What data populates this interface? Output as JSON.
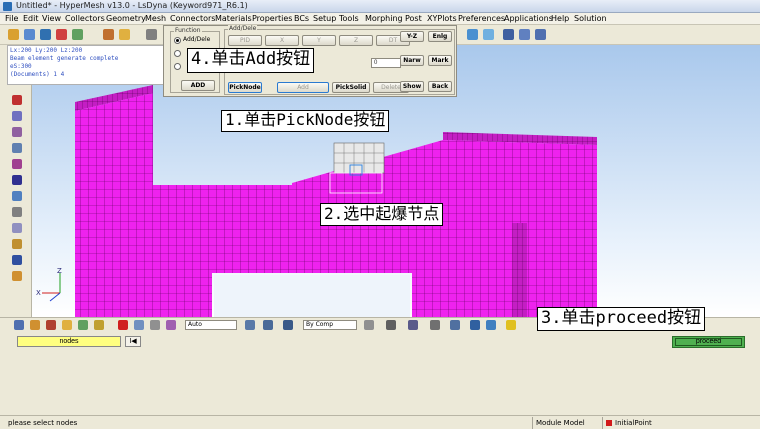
{
  "window": {
    "title": "Untitled* - HyperMesh v13.0 - LsDyna (Keyword971_R6.1)"
  },
  "menu": [
    "File",
    "Edit",
    "View",
    "Collectors",
    "Geometry",
    "Mesh",
    "Connectors",
    "Materials",
    "Properties",
    "BCs",
    "Setup",
    "Tools",
    "Morphing",
    "Post",
    "XYPlots",
    "Preferences",
    "Applications",
    "Help",
    "Solution"
  ],
  "command_log": [
    "Lx:200 Ly:200 Lz:200",
    "Beam element generate complete",
    "eS:300",
    "(Documents) 1 4"
  ],
  "function_panel": {
    "function_legend": "Function",
    "adddel_legend": "Add/Dele",
    "radio_adddele": "Add/Dele",
    "pid_label": "PID",
    "x_label": "X",
    "y_label": "Y",
    "z_label": "Z",
    "dt_label": "DT",
    "add_label": "ADD",
    "picknode_label": "PickNode",
    "add2_label": "Add",
    "picksolid_label": "PickSolid",
    "delete_label": "Delete",
    "value_field": "0"
  },
  "panel_right": {
    "yz": "Y-Z",
    "enlg": "Enlg",
    "narw": "Narw",
    "mark": "Mark",
    "show": "Show",
    "back": "Back"
  },
  "callouts": {
    "step1": "1.单击PickNode按钮",
    "step2": "2.选中起爆节点",
    "step3": "3.单击proceed按钮",
    "step4": "4.单击Add按钮"
  },
  "bottom_toolbar": {
    "auto": "Auto",
    "bycomp": "By Comp"
  },
  "panel": {
    "nodes": "nodes",
    "reverse": "I◀",
    "proceed": "proceed"
  },
  "status": {
    "message": "please select nodes",
    "model": "Module Model",
    "collector": "InitialPoint"
  },
  "colors": {
    "mesh": "#ee22ee",
    "mesh_line": "#5a005a",
    "proceed": "#4fb050",
    "nodes_field": "#ffff80"
  }
}
